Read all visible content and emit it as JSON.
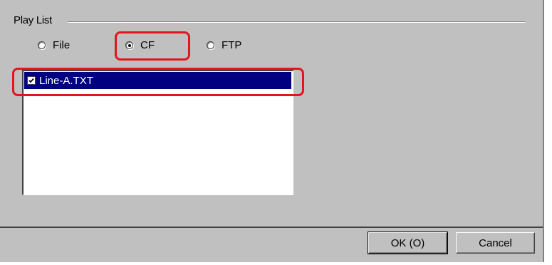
{
  "group": {
    "title": "Play List"
  },
  "source": {
    "options": [
      {
        "label": "File",
        "selected": false
      },
      {
        "label": "CF",
        "selected": true
      },
      {
        "label": "FTP",
        "selected": false
      }
    ]
  },
  "playlist": {
    "items": [
      {
        "label": "Line-A.TXT",
        "checked": true,
        "selected": true
      }
    ]
  },
  "buttons": {
    "ok_label": "OK (O)",
    "cancel_label": "Cancel"
  },
  "colors": {
    "highlight": "#e2171d",
    "selection": "#000080",
    "face": "#c0c0c0"
  }
}
